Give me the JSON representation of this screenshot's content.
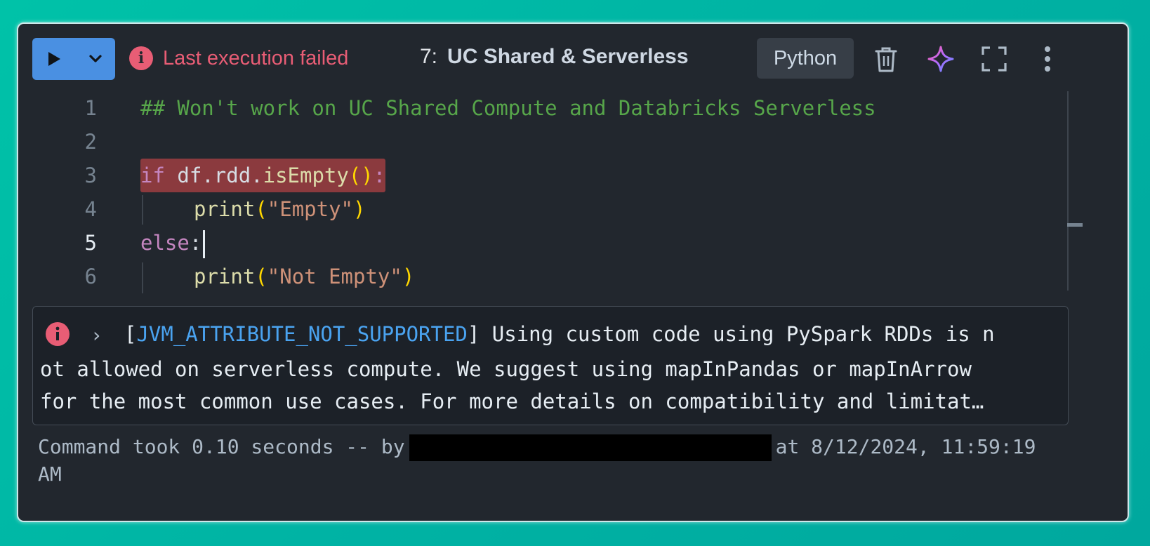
{
  "header": {
    "run_label": "Run",
    "status_text": "Last execution failed",
    "cell_number": "7:",
    "cell_title": "UC Shared & Serverless",
    "language": "Python"
  },
  "icons": {
    "run": "play-icon",
    "dropdown": "chevron-down-icon",
    "error": "error-icon",
    "delete": "trash-icon",
    "assistant": "sparkle-icon",
    "fullscreen": "fullscreen-icon",
    "menu": "kebab-menu-icon"
  },
  "editor": {
    "line_numbers": [
      "1",
      "2",
      "3",
      "4",
      "5",
      "6"
    ],
    "active_line": "5",
    "lines": {
      "l1": "## Won't work on UC Shared Compute and Databricks Serverless",
      "l3_kw": "if",
      "l3_obj": "df.rdd.",
      "l3_fn": "isEmpty",
      "l3_paren": "()",
      "l3_colon": ":",
      "l4_fn": "print",
      "l4_str": "\"Empty\"",
      "l5_kw": "else",
      "l5_colon": ":",
      "l6_fn": "print",
      "l6_str": "\"Not Empty\""
    }
  },
  "output": {
    "error_code": "JVM_ATTRIBUTE_NOT_SUPPORTED",
    "line1_rest": " Using custom code using PySpark RDDs is n",
    "line2": "ot allowed on serverless compute. We suggest using mapInPandas or mapInArrow",
    "line3": "for the most common use cases. For more details on compatibility and limitat…"
  },
  "footer": {
    "took": "Command took 0.10 seconds -- by",
    "at": "at 8/12/2024, 11:59:19",
    "am": "AM"
  },
  "colors": {
    "accent": "#4a90e2",
    "error": "#e85d75",
    "background": "#22272e"
  }
}
